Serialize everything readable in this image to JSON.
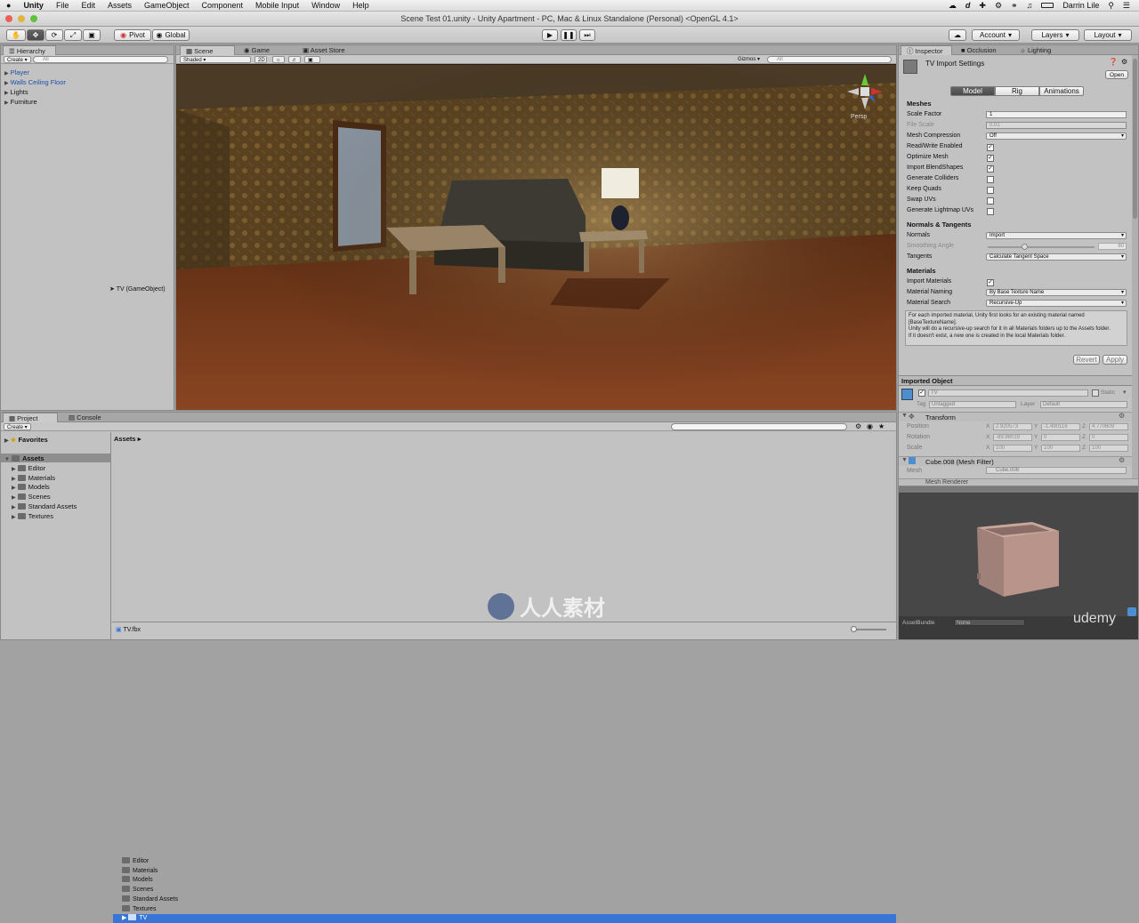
{
  "menubar": {
    "apple": "",
    "app": "Unity",
    "items": [
      "File",
      "Edit",
      "Assets",
      "GameObject",
      "Component",
      "Mobile Input",
      "Window",
      "Help"
    ],
    "user": "Darrin Lile",
    "status_icons": [
      "cloud-icon",
      "d-icon",
      "plus-icon",
      "wifi-icon",
      "sound-icon",
      "battery-icon",
      "user-icon",
      "search-icon",
      "list-icon"
    ]
  },
  "window": {
    "title": "Scene Test 01.unity - Unity Apartment - PC, Mac & Linux Standalone (Personal) <OpenGL 4.1>"
  },
  "toolbar": {
    "pivot": "Pivot",
    "global": "Global",
    "account": "Account",
    "layers": "Layers",
    "layout": "Layout"
  },
  "hierarchy": {
    "tab": "Hierarchy",
    "create": "Create",
    "search_placeholder": "All",
    "items": [
      {
        "label": "Player",
        "blue": true
      },
      {
        "label": "Walls Ceiling Floor",
        "blue": true
      },
      {
        "label": "Lights",
        "blue": false
      },
      {
        "label": "Furniture",
        "blue": false
      }
    ],
    "drag_label": "TV (GameObject)"
  },
  "scene": {
    "tabs": [
      "Scene",
      "Game",
      "Asset Store"
    ],
    "shading": "Shaded",
    "mode_2d": "2D",
    "gizmos": "Gizmos",
    "search_placeholder": "All",
    "persp": "Persp"
  },
  "inspector": {
    "tabs": [
      "Inspector",
      "Occlusion",
      "Lighting"
    ],
    "header": "TV Import Settings",
    "open": "Open",
    "subtabs": [
      "Model",
      "Rig",
      "Animations"
    ],
    "meshes_title": "Meshes",
    "meshes": [
      {
        "label": "Scale Factor",
        "type": "field",
        "value": "1"
      },
      {
        "label": "File Scale",
        "type": "field",
        "value": "0.01",
        "disabled": true
      },
      {
        "label": "Mesh Compression",
        "type": "dropdown",
        "value": "Off"
      },
      {
        "label": "Read/Write Enabled",
        "type": "check",
        "value": true
      },
      {
        "label": "Optimize Mesh",
        "type": "check",
        "value": true
      },
      {
        "label": "Import BlendShapes",
        "type": "check",
        "value": true
      },
      {
        "label": "Generate Colliders",
        "type": "check",
        "value": false
      },
      {
        "label": "Keep Quads",
        "type": "check",
        "value": false
      },
      {
        "label": "Swap UVs",
        "type": "check",
        "value": false
      },
      {
        "label": "Generate Lightmap UVs",
        "type": "check",
        "value": false
      }
    ],
    "normals_title": "Normals & Tangents",
    "normals": [
      {
        "label": "Normals",
        "type": "dropdown",
        "value": "Import"
      },
      {
        "label": "Smoothing Angle",
        "type": "slider",
        "value": "60",
        "disabled": true
      },
      {
        "label": "Tangents",
        "type": "dropdown",
        "value": "Calculate Tangent Space"
      }
    ],
    "materials_title": "Materials",
    "materials": [
      {
        "label": "Import Materials",
        "type": "check",
        "value": true
      },
      {
        "label": "Material Naming",
        "type": "dropdown",
        "value": "By Base Texture Name"
      },
      {
        "label": "Material Search",
        "type": "dropdown",
        "value": "Recursive-Up"
      }
    ],
    "help_text": [
      "For each imported material, Unity first looks for an existing material named [BaseTextureName].",
      "Unity will do a recursive-up search for it in all Materials folders up to the Assets folder.",
      "If it doesn't exist, a new one is created in the local Materials folder."
    ],
    "revert": "Revert",
    "apply": "Apply",
    "imported_object": "Imported Object",
    "object_name": "TV",
    "static": "Static",
    "tag_label": "Tag",
    "tag_value": "Untagged",
    "layer_label": "Layer",
    "layer_value": "Default",
    "transform_title": "Transform",
    "position_label": "Position",
    "rotation_label": "Rotation",
    "scale_label": "Scale",
    "position": [
      "2.920573",
      "-1.490116",
      "4.770609"
    ],
    "rotation": [
      "-89.98019",
      "0",
      "0"
    ],
    "scale": [
      "100",
      "100",
      "100"
    ],
    "mesh_filter_title": "Cube.008 (Mesh Filter)",
    "mesh_label": "Mesh",
    "mesh_value": "Cube.008",
    "mesh_renderer_title": "Mesh Renderer",
    "assetbundle_label": "AssetBundle",
    "assetbundle_value": "None",
    "xyz": [
      "X",
      "Y",
      "Z"
    ]
  },
  "project": {
    "tabs": [
      "Project",
      "Console"
    ],
    "create": "Create",
    "favorites": "Favorites",
    "tree_root": "Assets",
    "tree": [
      "Editor",
      "Materials",
      "Models",
      "Scenes",
      "Standard Assets",
      "Textures"
    ],
    "breadcrumb": "Assets",
    "files": [
      "Editor",
      "Materials",
      "Models",
      "Scenes",
      "Standard Assets",
      "Textures",
      "TV"
    ],
    "selected_file": "TV",
    "footer_file": "TV.fbx"
  },
  "watermark": {
    "logo_text": "人人素材",
    "site": "udemy"
  },
  "colors": {
    "selection": "#3875d7",
    "bg": "#c2c2c2",
    "play_dark": "#4a4a4a"
  }
}
